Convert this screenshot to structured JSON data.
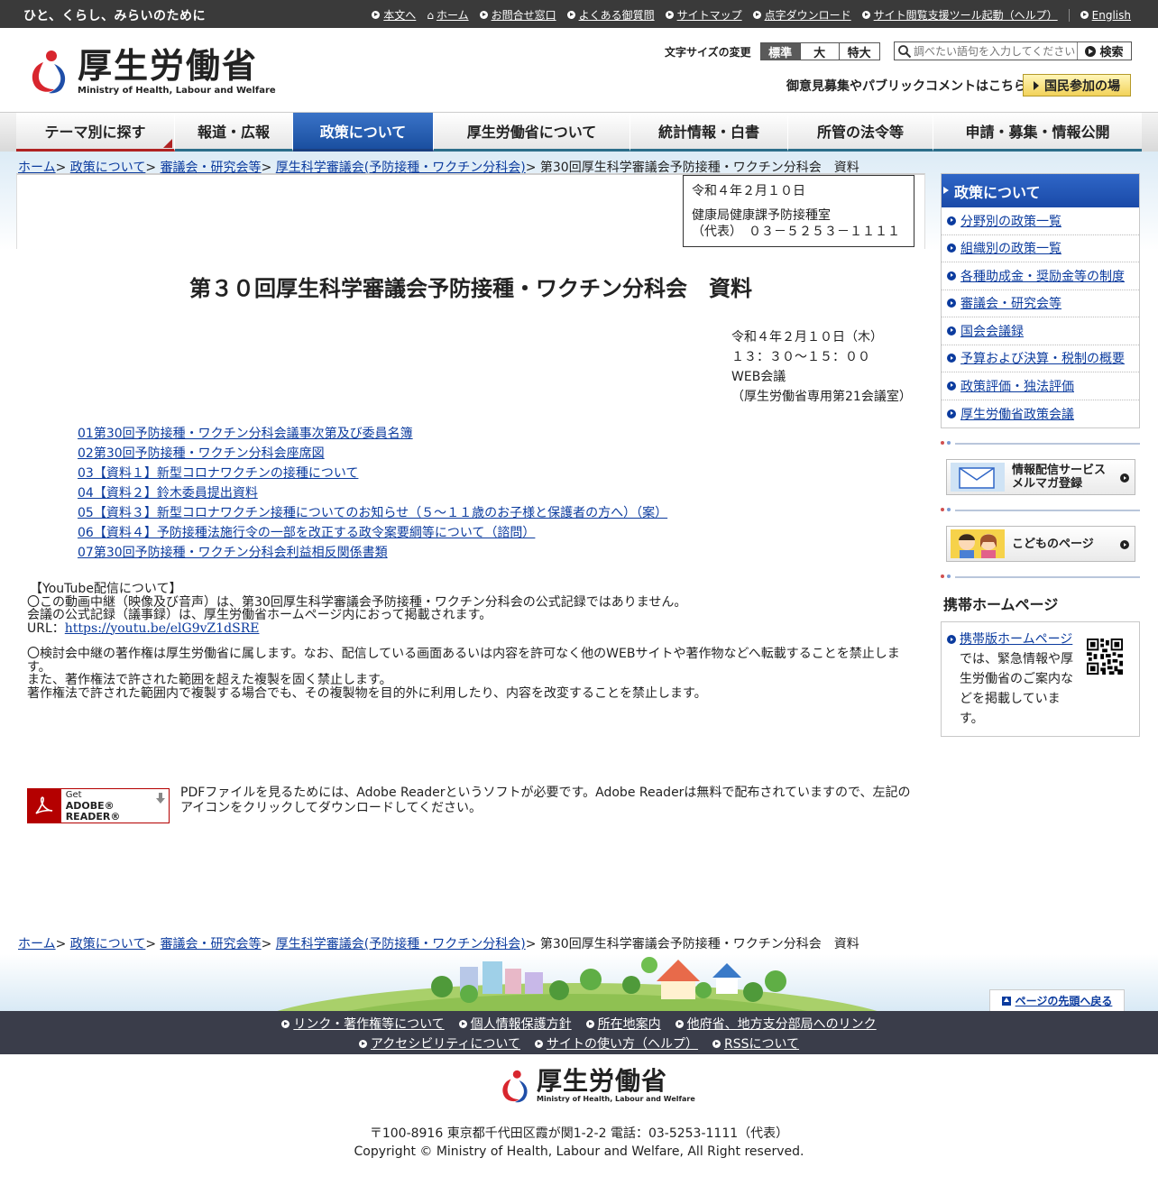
{
  "topbar": {
    "tagline": "ひと、くらし、みらいのために",
    "links": [
      "本文へ",
      "ホーム",
      "お問合せ窓口",
      "よくある御質問",
      "サイトマップ",
      "点字ダウンロード",
      "サイト閲覧支援ツール起動（ヘルプ）"
    ],
    "english": "English"
  },
  "header": {
    "logo_jp": "厚生労働省",
    "logo_en": "Ministry of Health, Labour and Welfare",
    "fontsize_label": "文字サイズの変更",
    "fontsize_options": [
      "標準",
      "大",
      "特大"
    ],
    "search_placeholder": "調べたい語句を入力してください",
    "search_button": "検索",
    "public_comment": "御意見募集やパブリックコメントはこちら",
    "kokumin_button": "国民参加の場"
  },
  "gnav": [
    "テーマ別に探す",
    "報道・広報",
    "政策について",
    "厚生労働省について",
    "統計情報・白書",
    "所管の法令等",
    "申請・募集・情報公開"
  ],
  "breadcrumb": {
    "links": [
      "ホーム",
      "政策について",
      "審議会・研究会等",
      "厚生科学審議会(予防接種・ワクチン分科会)"
    ],
    "current": "第30回厚生科学審議会予防接種・ワクチン分科会　資料",
    "sep": ">"
  },
  "info_box": {
    "date": "令和４年２月１０日",
    "dept": "健康局健康課予防接種室",
    "tel": "（代表）　０３－５２５３－１１１１"
  },
  "page_title": "第３０回厚生科学審議会予防接種・ワクチン分科会　資料",
  "meeting": {
    "date": "令和４年２月１０日（木）",
    "time": "１３：３０～１５：００",
    "place": "WEB会議",
    "room": "（厚生労働省専用第21会議室）"
  },
  "documents": [
    "01第30回予防接種・ワクチン分科会議事次第及び委員名簿",
    "02第30回予防接種・ワクチン分科会座席図",
    "03【資料１】新型コロナワクチンの接種について",
    "04【資料２】鈴木委員提出資料",
    "05【資料３】新型コロナワクチン接種についてのお知らせ（５～１１歳のお子様と保護者の方へ）（案）",
    "06【資料４】予防接種法施行令の一部を改正する政令案要綱等について（諮問）",
    "07第30回予防接種・ワクチン分科会利益相反関係書類"
  ],
  "youtube": {
    "heading": "【YouTube配信について】",
    "line1": "〇この動画中継（映像及び音声）は、第30回厚生科学審議会予防接種・ワクチン分科会の公式記録ではありません。",
    "line2": "会議の公式記録（議事録）は、厚生労働省ホームページ内におって掲載されます。",
    "url_label": "URL：",
    "url": "https://youtu.be/elG9vZ1dSRE",
    "line3": "〇検討会中継の著作権は厚生労働省に属します。なお、配信している画面あるいは内容を許可なく他のWEBサイトや著作物などへ転載することを禁止します。",
    "line4": "また、著作権法で許された範囲を超えた複製を固く禁止します。",
    "line5": "著作権法で許された範囲内で複製する場合でも、その複製物を目的外に利用したり、内容を改変することを禁止します。"
  },
  "adobe": {
    "get": "Get",
    "name": "ADOBE® READER®",
    "desc": "PDFファイルを見るためには、Adobe Readerというソフトが必要です。Adobe Readerは無料で配布されていますので、左記のアイコンをクリックしてダウンロードしてください。"
  },
  "side": {
    "title": "政策について",
    "items": [
      "分野別の政策一覧",
      "組織別の政策一覧",
      "各種助成金・奨励金等の制度",
      "審議会・研究会等",
      "国会会議録",
      "予算および決算・税制の概要",
      "政策評価・独法評価",
      "厚生労働省政策会議"
    ],
    "mail_banner_line1": "情報配信サービス",
    "mail_banner_line2": "メルマガ登録",
    "kids_banner": "こどものページ",
    "mobile_title": "携帯ホームページ",
    "mobile_link": "携帯版ホームページ",
    "mobile_text": "では、緊急情報や厚生労働省のご案内などを掲載しています。"
  },
  "footer": {
    "back_top": "ページの先頭へ戻る",
    "links_row1": [
      "リンク・著作権等について",
      "個人情報保護方針",
      "所在地案内",
      "他府省、地方支分部局へのリンク"
    ],
    "links_row2": [
      "アクセシビリティについて",
      "サイトの使い方（ヘルプ）",
      "RSSについて"
    ],
    "logo_jp": "厚生労働省",
    "logo_en": "Ministry of Health, Labour and Welfare",
    "address": "〒100-8916 東京都千代田区霞が関1-2-2 電話：03-5253-1111（代表）",
    "copyright": "Copyright © Ministry of Health, Labour and Welfare, All Right reserved."
  },
  "colors": {
    "topbar": "#3a3a3a",
    "nav_active": "#1a4fa0",
    "link": "#0b3b9e",
    "footer_bar": "#3a3d4a",
    "logo_red": "#d8262e",
    "logo_blue": "#1f4ea8"
  }
}
